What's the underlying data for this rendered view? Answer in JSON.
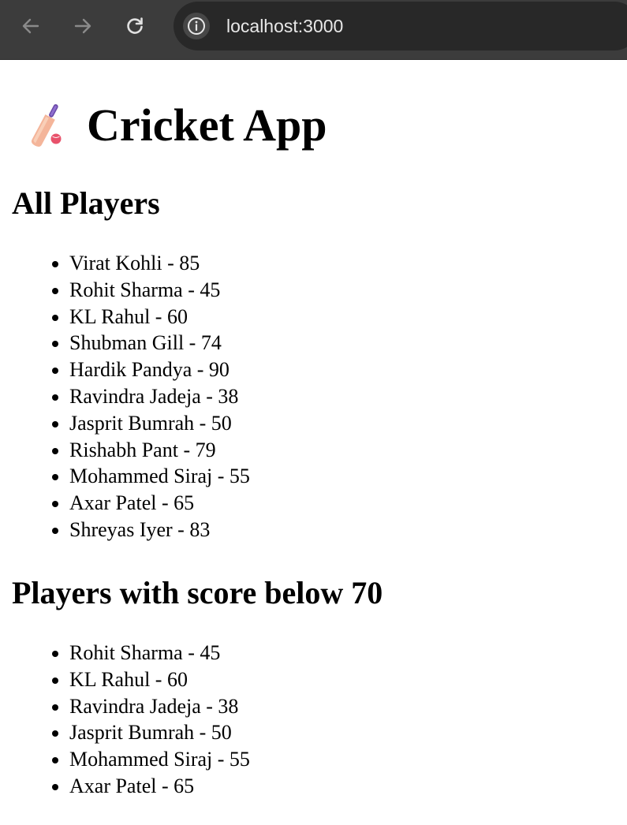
{
  "browser": {
    "url": "localhost:3000"
  },
  "page": {
    "title": "Cricket App",
    "sections": [
      {
        "heading": "All Players",
        "players": [
          "Virat Kohli - 85",
          "Rohit Sharma - 45",
          "KL Rahul - 60",
          "Shubman Gill - 74",
          "Hardik Pandya - 90",
          "Ravindra Jadeja - 38",
          "Jasprit Bumrah - 50",
          "Rishabh Pant - 79",
          "Mohammed Siraj - 55",
          "Axar Patel - 65",
          "Shreyas Iyer - 83"
        ]
      },
      {
        "heading": "Players with score below 70",
        "players": [
          "Rohit Sharma - 45",
          "KL Rahul - 60",
          "Ravindra Jadeja - 38",
          "Jasprit Bumrah - 50",
          "Mohammed Siraj - 55",
          "Axar Patel - 65"
        ]
      }
    ]
  },
  "colors": {
    "toolbar_bg": "#3c3c3c",
    "omnibox_bg": "#282828",
    "page_bg": "#ffffff",
    "text": "#000000"
  },
  "icons": {
    "title_icon": "cricket-bat-icon",
    "back": "arrow-left-icon",
    "forward": "arrow-right-icon",
    "reload": "reload-icon",
    "site_info": "info-icon"
  }
}
